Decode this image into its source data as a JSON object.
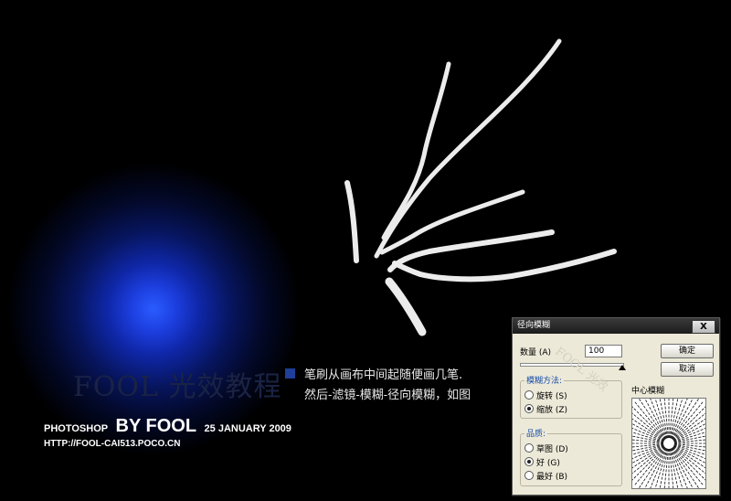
{
  "watermark_text": "FOOL 光效教程",
  "branding": {
    "prefix": "PHOTOSHOP",
    "by": "BY FOOL",
    "date": "25 JANUARY 2009",
    "url": "HTTP://FOOL-CAI513.POCO.CN"
  },
  "note": {
    "line1": "笔刷从画布中间起随便画几笔.",
    "line2": "然后-滤镜-模糊-径向模糊，如图"
  },
  "dialog": {
    "title": "径向模糊",
    "close_label": "X",
    "amount_label": "数量 (A)",
    "amount_value": "100",
    "amount_fraction": 1.0,
    "ok_label": "确定",
    "cancel_label": "取消",
    "method_legend": "模糊方法:",
    "method_options": [
      "旋转 (S)",
      "缩放 (Z)"
    ],
    "method_selected": 1,
    "quality_legend": "品质:",
    "quality_options": [
      "草图 (D)",
      "好 (G)",
      "最好 (B)"
    ],
    "quality_selected": 1,
    "center_label": "中心模糊",
    "overlay_watermark": "FOOL 光效"
  },
  "colors": {
    "background": "#000000",
    "glow": "#1d3fe0",
    "strokes": "#ececec",
    "dialog_bg": "#ece9d8"
  }
}
